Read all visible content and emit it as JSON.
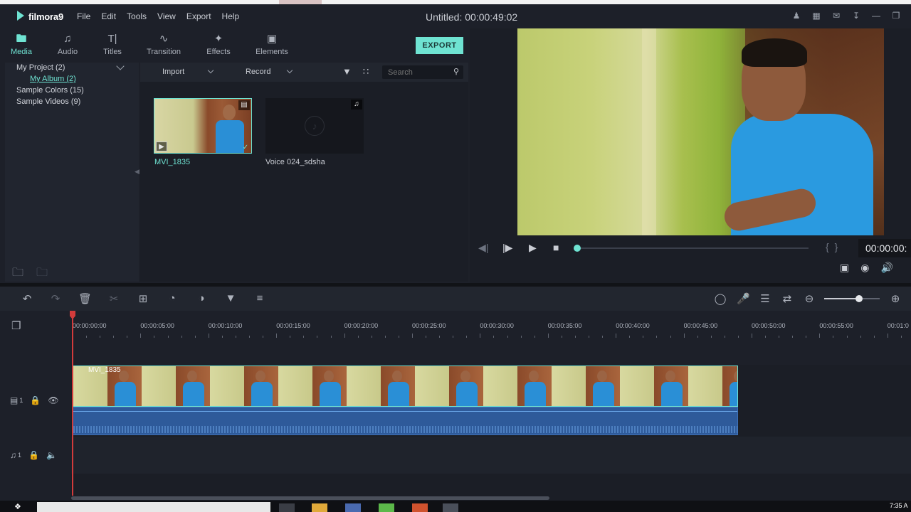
{
  "app": {
    "logo": "filmora9",
    "title": "Untitled:",
    "duration": "00:00:49:02",
    "menu": [
      "File",
      "Edit",
      "Tools",
      "View",
      "Export",
      "Help"
    ]
  },
  "tabs": [
    {
      "label": "Media",
      "icon": "folder-icon",
      "active": true
    },
    {
      "label": "Audio",
      "icon": "music-note-icon"
    },
    {
      "label": "Titles",
      "icon": "text-icon"
    },
    {
      "label": "Transition",
      "icon": "transition-icon"
    },
    {
      "label": "Effects",
      "icon": "effects-icon"
    },
    {
      "label": "Elements",
      "icon": "image-icon"
    }
  ],
  "export_label": "EXPORT",
  "library": {
    "items": [
      {
        "label": "My Project (2)"
      },
      {
        "label": "My Album (2)",
        "sub": true
      },
      {
        "label": "Sample Colors (15)"
      },
      {
        "label": "Sample Videos (9)"
      }
    ]
  },
  "media_toolbar": {
    "import_label": "Import",
    "record_label": "Record",
    "search_placeholder": "Search"
  },
  "media_items": [
    {
      "name": "MVI_1835",
      "type": "video",
      "selected": true
    },
    {
      "name": "Voice 024_sdsha",
      "type": "audio"
    }
  ],
  "preview": {
    "timecode": "00:00:00:",
    "progress": 0.0
  },
  "ruler": {
    "labels": [
      "00:00:00:00",
      "00:00:05:00",
      "00:00:10:00",
      "00:00:15:00",
      "00:00:20:00",
      "00:00:25:00",
      "00:00:30:00",
      "00:00:35:00",
      "00:00:40:00",
      "00:00:45:00",
      "00:00:50:00",
      "00:00:55:00",
      "00:01:0"
    ]
  },
  "timeline": {
    "video_clip_label": "MVI_1835",
    "video_track_label": "1",
    "audio_track_label": "1",
    "zoom_level": 0.6
  },
  "taskbar": {
    "clock": "7:35 A"
  },
  "colors": {
    "accent": "#6fe3d2",
    "playhead": "#d23b3b",
    "audio_clip": "#2e5a9a"
  }
}
